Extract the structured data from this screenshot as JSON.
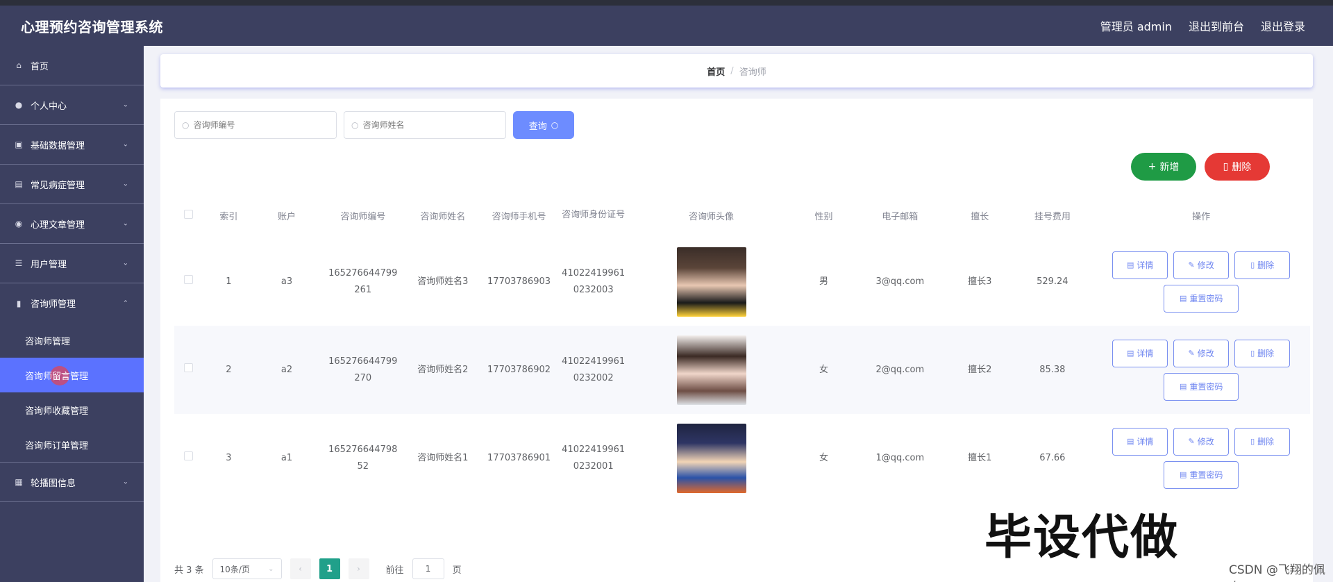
{
  "header": {
    "title": "心理预约咨询管理系统",
    "admin_label": "管理员 admin",
    "back_front": "退出到前台",
    "logout": "退出登录"
  },
  "sidebar": {
    "items": [
      {
        "label": "首页",
        "icon": "home-icon"
      },
      {
        "label": "个人中心",
        "icon": "user-icon"
      },
      {
        "label": "基础数据管理",
        "icon": "database-icon"
      },
      {
        "label": "常见病症管理",
        "icon": "clipboard-icon"
      },
      {
        "label": "心理文章管理",
        "icon": "location-icon"
      },
      {
        "label": "用户管理",
        "icon": "sliders-icon"
      },
      {
        "label": "咨询师管理",
        "icon": "bar-chart-icon"
      }
    ],
    "subitems": [
      {
        "label": "咨询师管理"
      },
      {
        "label": "咨询师留言管理"
      },
      {
        "label": "咨询师收藏管理"
      },
      {
        "label": "咨询师订单管理"
      }
    ],
    "last_item": {
      "label": "轮播图信息",
      "icon": "image-icon"
    }
  },
  "breadcrumb": {
    "home": "首页",
    "separator": "/",
    "current": "咨询师"
  },
  "search": {
    "code_placeholder": "咨询师编号",
    "name_placeholder": "咨询师姓名",
    "query_label": "查询"
  },
  "actions": {
    "add_label": "新增",
    "delete_label": "删除"
  },
  "table": {
    "headers": [
      "索引",
      "账户",
      "咨询师编号",
      "咨询师姓名",
      "咨询师手机号",
      "咨询师身份证号",
      "咨询师头像",
      "性别",
      "电子邮箱",
      "擅长",
      "挂号费用",
      "操作"
    ],
    "rows": [
      {
        "index": "1",
        "account": "a3",
        "code": "165276644799261",
        "name": "咨询师姓名3",
        "phone": "17703786903",
        "idcard": "410224199610232003",
        "gender": "男",
        "email": "3@qq.com",
        "specialty": "擅长3",
        "fee": "529.24"
      },
      {
        "index": "2",
        "account": "a2",
        "code": "165276644799270",
        "name": "咨询师姓名2",
        "phone": "17703786902",
        "idcard": "410224199610232002",
        "gender": "女",
        "email": "2@qq.com",
        "specialty": "擅长2",
        "fee": "85.38"
      },
      {
        "index": "3",
        "account": "a1",
        "code": "16527664479852",
        "name": "咨询师姓名1",
        "phone": "17703786901",
        "idcard": "410224199610232001",
        "gender": "女",
        "email": "1@qq.com",
        "specialty": "擅长1",
        "fee": "67.66"
      }
    ],
    "op_labels": {
      "detail": "详情",
      "edit": "修改",
      "delete": "删除",
      "reset": "重置密码"
    }
  },
  "pager": {
    "total": "共 3 条",
    "page_size": "10条/页",
    "current_page": "1",
    "goto_prefix": "前往",
    "goto_value": "1",
    "goto_suffix": "页"
  },
  "watermark": {
    "big": "毕设代做",
    "small": "CSDN @飞翔的佩奇"
  },
  "colors": {
    "header_bg": "#3c4060",
    "accent": "#5b72ff",
    "add": "#1f9b45",
    "delete": "#e53935",
    "page_active": "#20a08a"
  }
}
